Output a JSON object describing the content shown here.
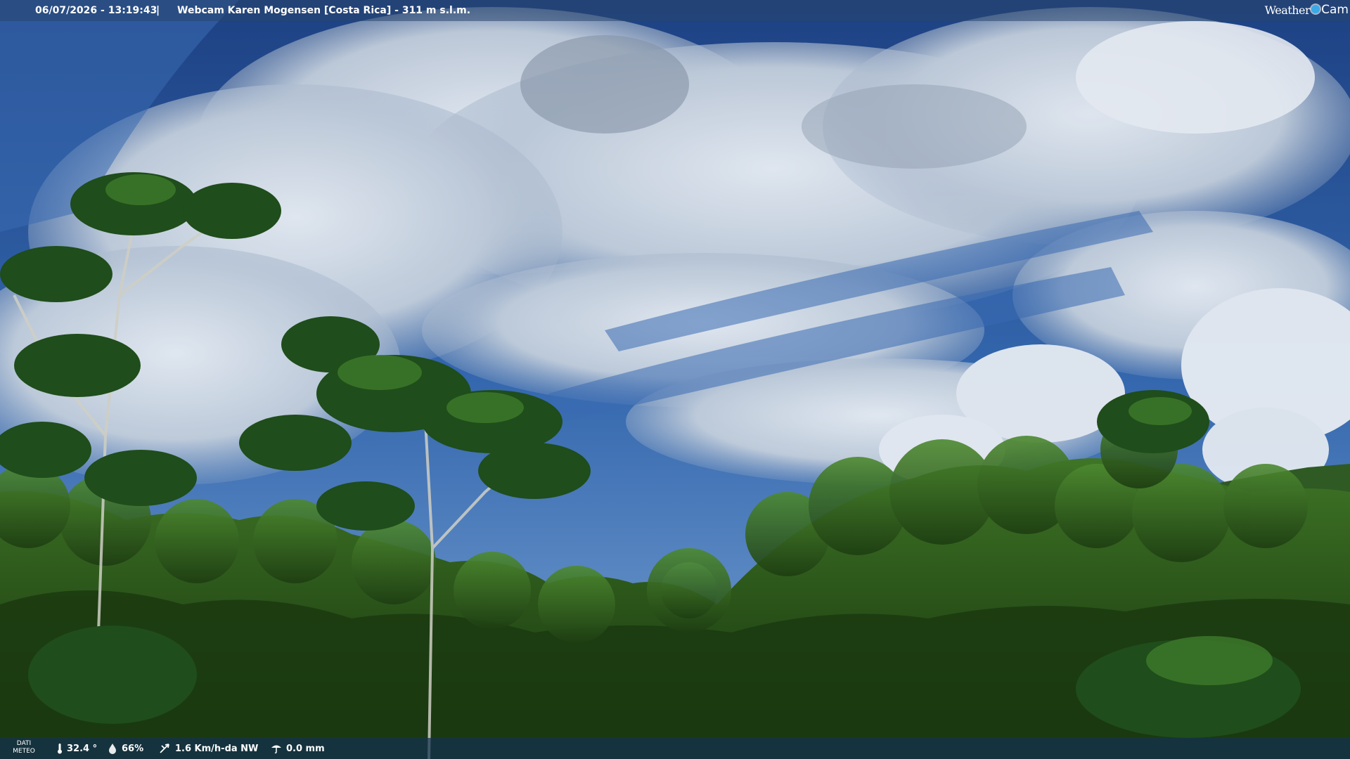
{
  "overlay": {
    "timestamp": "06/07/2026 - 13:19:43",
    "separator": "|",
    "title": "Webcam Karen Mogensen [Costa Rica] - 311 m s.l.m.",
    "logo_weather": "Weather",
    "logo_cam": "Cam"
  },
  "meteo": {
    "label_line1": "DATI",
    "label_line2": "METEO",
    "temperature": "32.4 °",
    "humidity": "66%",
    "wind": "1.6 Km/h-da NW",
    "rain": "0.0 mm",
    "icons": [
      "thermometer-icon",
      "humidity-icon",
      "wind-icon",
      "rain-icon"
    ]
  },
  "colors": {
    "sky": "#2f5fa8",
    "foliage": "#2c5a1a",
    "bar": "#1e4a6e"
  }
}
